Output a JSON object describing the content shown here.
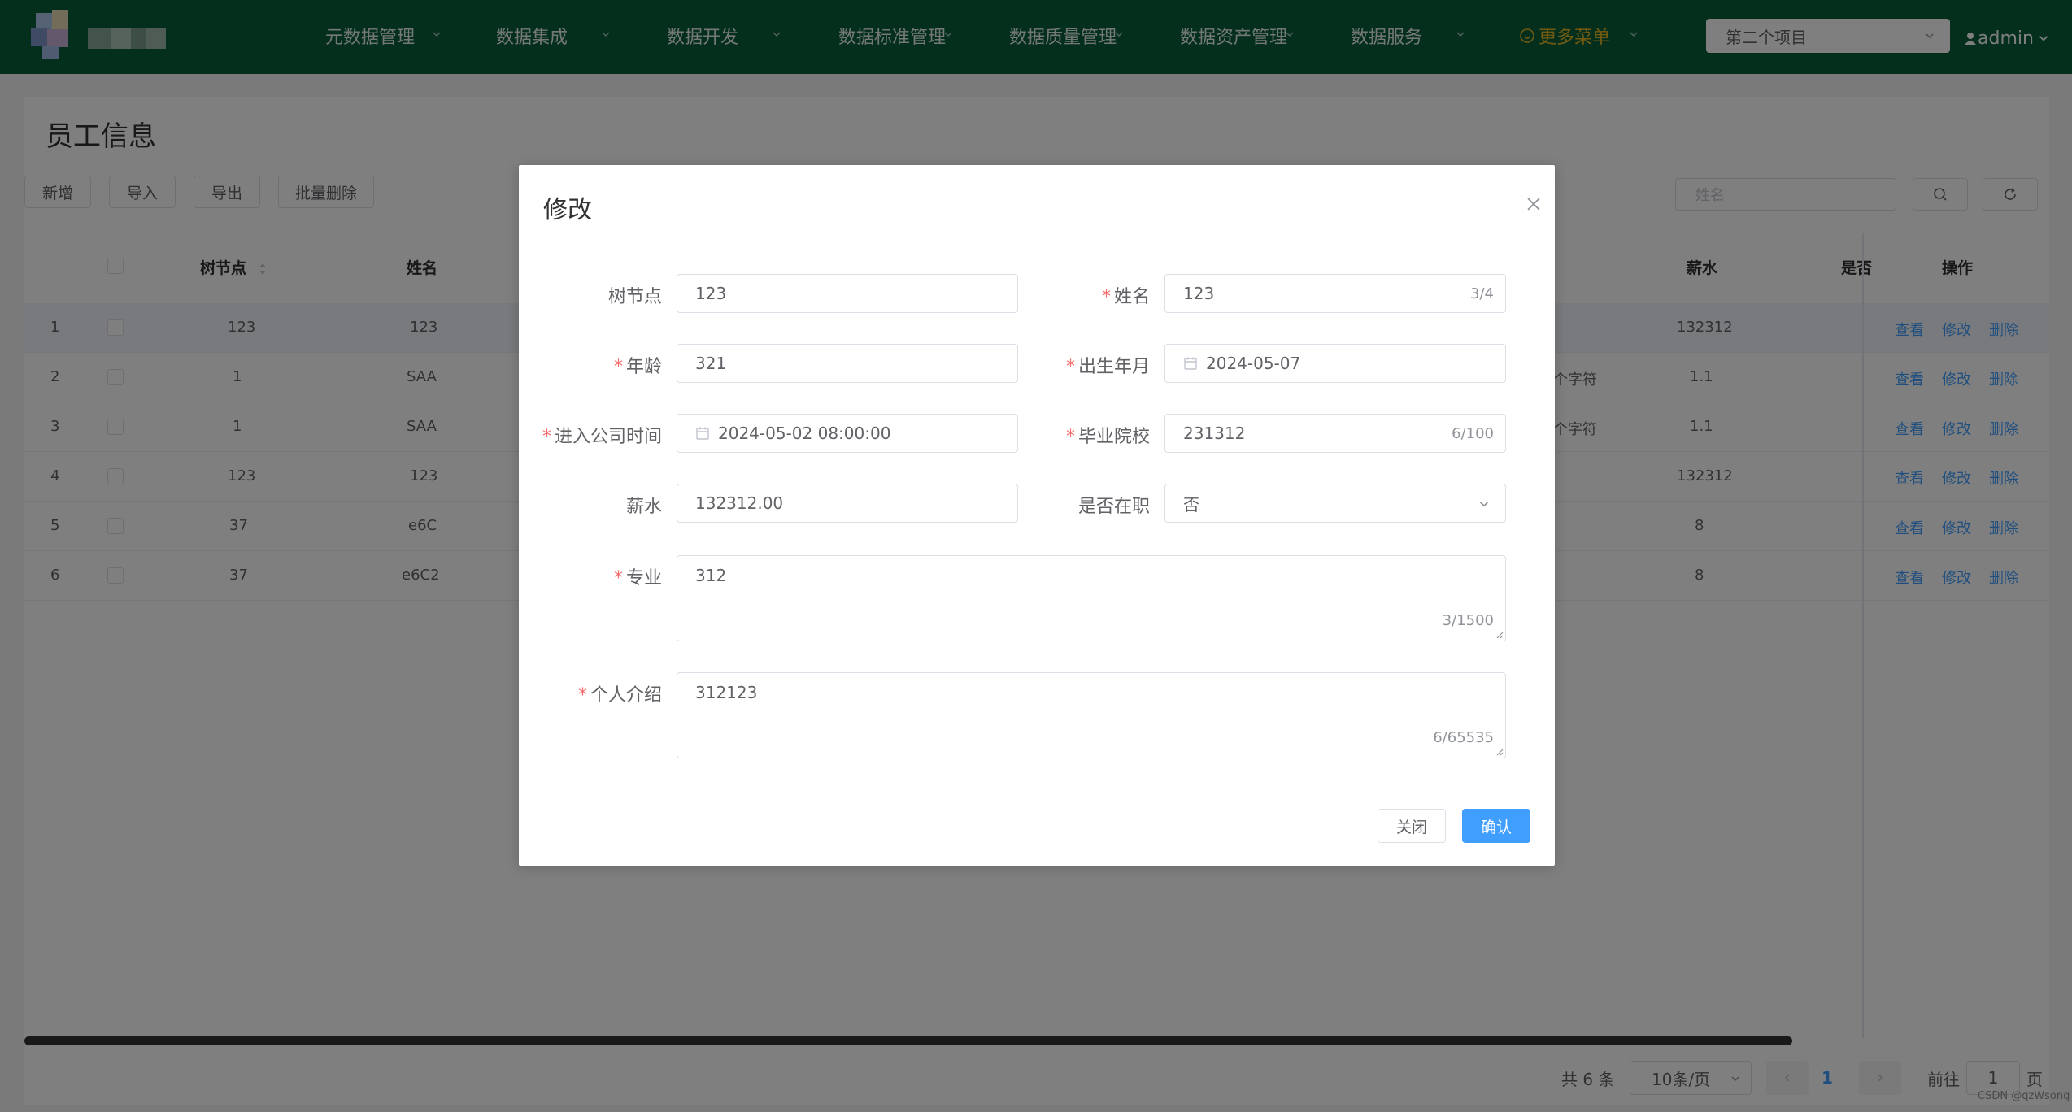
{
  "nav": {
    "items": [
      {
        "label": "元数据管理"
      },
      {
        "label": "数据集成"
      },
      {
        "label": "数据开发"
      },
      {
        "label": "数据标准管理"
      },
      {
        "label": "数据质量管理"
      },
      {
        "label": "数据资产管理"
      },
      {
        "label": "数据服务"
      }
    ],
    "more_label": "更多菜单",
    "project_select": "第二个项目",
    "user": "admin",
    "bg_color": "#0b5f3a",
    "more_color": "#e6b422"
  },
  "page": {
    "title": "员工信息",
    "toolbar": {
      "add": "新增",
      "import": "导入",
      "export": "导出",
      "batch_delete": "批量删除"
    },
    "search_placeholder": "姓名",
    "table": {
      "headers": {
        "tree_node": "树节点",
        "name": "姓名",
        "salary": "薪水",
        "employed": "是否",
        "actions": "操作"
      },
      "rows": [
        {
          "index": "1",
          "tree_node": "123",
          "name": "123",
          "extra": "",
          "salary": "132312"
        },
        {
          "index": "2",
          "tree_node": "1",
          "name": "SAA",
          "extra": "个字符",
          "salary": "1.1"
        },
        {
          "index": "3",
          "tree_node": "1",
          "name": "SAA",
          "extra": "个字符",
          "salary": "1.1"
        },
        {
          "index": "4",
          "tree_node": "123",
          "name": "123",
          "extra": "",
          "salary": "132312"
        },
        {
          "index": "5",
          "tree_node": "37",
          "name": "e6C",
          "extra": "",
          "salary": "8"
        },
        {
          "index": "6",
          "tree_node": "37",
          "name": "e6C2",
          "extra": "",
          "salary": "8"
        }
      ],
      "row_actions": {
        "view": "查看",
        "edit": "修改",
        "delete": "删除"
      }
    },
    "pagination": {
      "total": "共 6 条",
      "page_size": "10条/页",
      "current": "1",
      "goto_label": "前往",
      "goto_value": "1",
      "page_suffix": "页"
    },
    "watermark": "CSDN @qzWsong"
  },
  "dialog": {
    "title": "修改",
    "fields": {
      "tree_node": {
        "label": "树节点",
        "value": "123"
      },
      "name": {
        "label": "姓名",
        "value": "123",
        "count": "3/4"
      },
      "age": {
        "label": "年龄",
        "value": "321"
      },
      "birth": {
        "label": "出生年月",
        "value": "2024-05-07"
      },
      "join_time": {
        "label": "进入公司时间",
        "value": "2024-05-02 08:00:00"
      },
      "school": {
        "label": "毕业院校",
        "value": "231312",
        "count": "6/100"
      },
      "salary": {
        "label": "薪水",
        "value": "132312.00"
      },
      "employed": {
        "label": "是否在职",
        "value": "否"
      },
      "major": {
        "label": "专业",
        "value": "312",
        "count": "3/1500"
      },
      "intro": {
        "label": "个人介绍",
        "value": "312123",
        "count": "6/65535"
      }
    },
    "buttons": {
      "close": "关闭",
      "confirm": "确认"
    },
    "primary_color": "#409eff",
    "required_color": "#f56c6c"
  }
}
